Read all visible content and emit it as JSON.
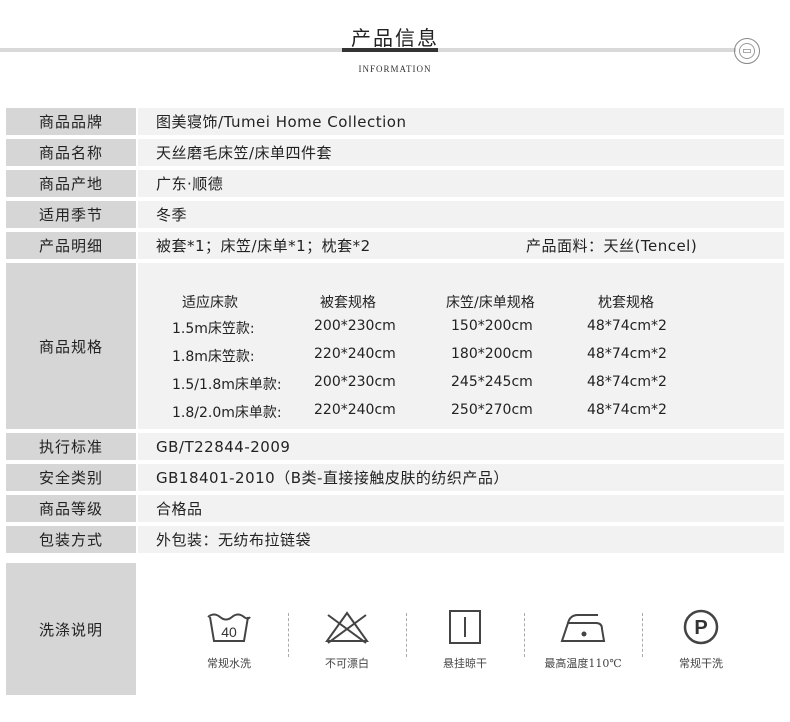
{
  "header": {
    "title": "产品信息",
    "subtitle": "INFORMATION",
    "seal_icon": "seal-emblem"
  },
  "rows": [
    {
      "label": "商品品牌",
      "value": "图美寝饰/Tumei Home Collection"
    },
    {
      "label": "商品名称",
      "value": "天丝磨毛床笠/床单四件套"
    },
    {
      "label": "商品产地",
      "value": "广东·顺德"
    },
    {
      "label": "适用季节",
      "value": "冬季"
    },
    {
      "label": "产品明细",
      "value": "被套*1；床笠/床单*1；枕套*2",
      "value_right": "产品面料：天丝(Tencel)"
    }
  ],
  "spec": {
    "label": "商品规格",
    "headers": [
      "适应床款",
      "被套规格",
      "床笠/床单规格",
      "枕套规格"
    ],
    "rows": [
      [
        "1.5m床笠款:",
        "200*230cm",
        "150*200cm",
        "48*74cm*2"
      ],
      [
        "1.8m床笠款:",
        "220*240cm",
        "180*200cm",
        "48*74cm*2"
      ],
      [
        "1.5/1.8m床单款:",
        "200*230cm",
        "245*245cm",
        "48*74cm*2"
      ],
      [
        "1.8/2.0m床单款:",
        "220*240cm",
        "250*270cm",
        "48*74cm*2"
      ]
    ]
  },
  "rows2": [
    {
      "label": "执行标准",
      "value": "GB/T22844-2009"
    },
    {
      "label": "安全类别",
      "value": "GB18401-2010（B类-直接接触皮肤的纺织产品）"
    },
    {
      "label": "商品等级",
      "value": "合格品"
    },
    {
      "label": "包装方式",
      "value": "外包装：无纺布拉链袋"
    }
  ],
  "care": {
    "label": "洗涤说明",
    "items": [
      {
        "icon": "wash-40-icon",
        "text": "40",
        "caption": "常规水洗"
      },
      {
        "icon": "no-bleach-icon",
        "caption": "不可漂白"
      },
      {
        "icon": "hang-dry-icon",
        "caption": "悬挂晾干"
      },
      {
        "icon": "iron-icon",
        "caption": "最高温度110℃"
      },
      {
        "icon": "dry-clean-p-icon",
        "text": "P",
        "caption": "常规干洗"
      }
    ]
  },
  "colors": {
    "label_bg": "#d6d6d6",
    "value_bg": "#f2f2f2",
    "title_bar": "#333333"
  }
}
